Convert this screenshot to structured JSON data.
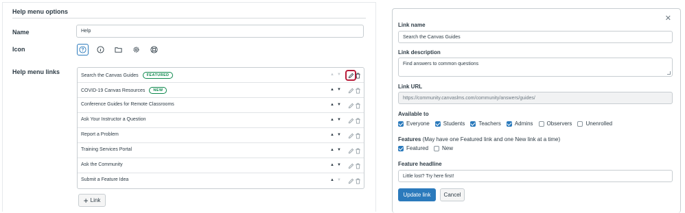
{
  "help_menu": {
    "section_title": "Help menu options",
    "name_label": "Name",
    "name_value": "Help",
    "icon_label": "Icon",
    "icons": [
      "question-icon",
      "info-icon",
      "folder-icon",
      "cog-icon",
      "lifesaver-icon"
    ],
    "selected_icon": "question-icon",
    "links_label": "Help menu links",
    "links": [
      {
        "label": "Search the Canvas Guides",
        "badge": "FEATURED",
        "badge_type": "featured"
      },
      {
        "label": "COVID-19 Canvas Resources",
        "badge": "NEW",
        "badge_type": "new"
      },
      {
        "label": "Conference Guides for Remote Classrooms",
        "badge": ""
      },
      {
        "label": "Ask Your Instructor a Question",
        "badge": ""
      },
      {
        "label": "Report a Problem",
        "badge": ""
      },
      {
        "label": "Training Services Portal",
        "badge": ""
      },
      {
        "label": "Ask the Community",
        "badge": ""
      },
      {
        "label": "Submit a Feature Idea",
        "badge": ""
      }
    ],
    "add_link_label": "Link"
  },
  "edit_panel": {
    "link_name_label": "Link name",
    "link_name_value": "Search the Canvas Guides",
    "link_description_label": "Link description",
    "link_description_value": "Find answers to common questions",
    "link_url_label": "Link URL",
    "link_url_value": "https://community.canvaslms.com/community/answers/guides/",
    "available_to_label": "Available to",
    "available_to": [
      {
        "label": "Everyone",
        "checked": true
      },
      {
        "label": "Students",
        "checked": true
      },
      {
        "label": "Teachers",
        "checked": true
      },
      {
        "label": "Admins",
        "checked": true
      },
      {
        "label": "Observers",
        "checked": false
      },
      {
        "label": "Unenrolled",
        "checked": false
      }
    ],
    "features_label": "Features",
    "features_note": "(May have one Featured link and one New link at a time)",
    "features": [
      {
        "label": "Featured",
        "checked": true
      },
      {
        "label": "New",
        "checked": false
      }
    ],
    "feature_headline_label": "Feature headline",
    "feature_headline_value": "Little lost? Try here first!",
    "update_button": "Update link",
    "cancel_button": "Cancel"
  },
  "colors": {
    "primary": "#2b7abc",
    "badge_green": "#0b874b",
    "highlight_red": "#b81d3a"
  }
}
